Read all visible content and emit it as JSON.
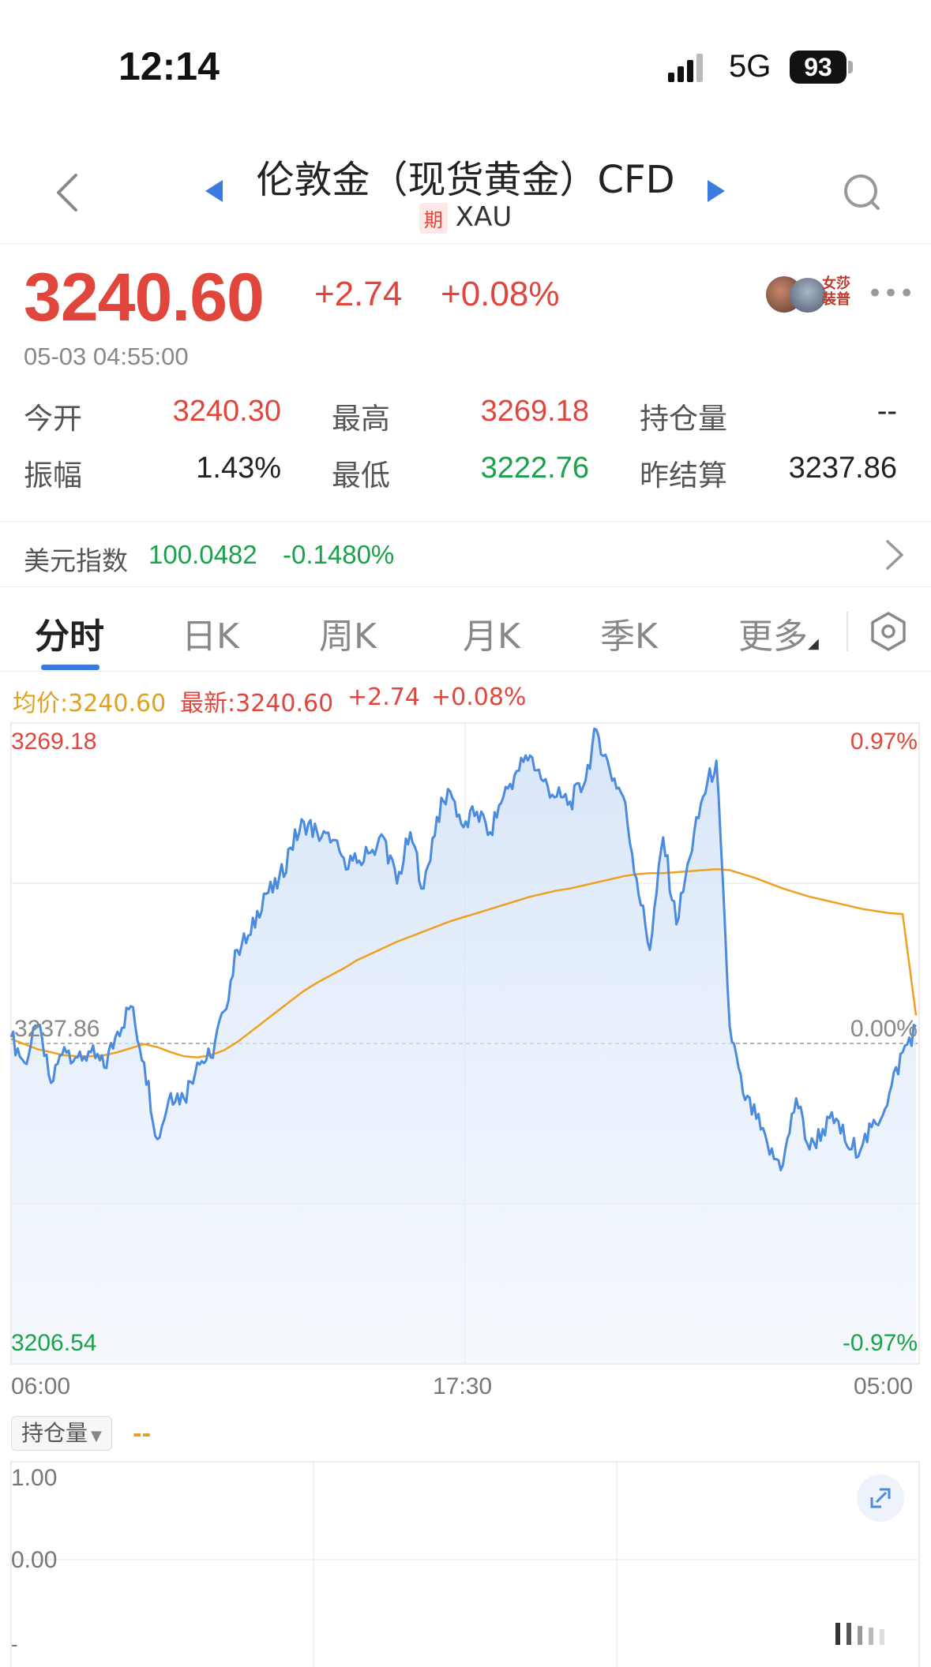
{
  "status_bar": {
    "time": "12:14",
    "network": "5G",
    "battery": "93"
  },
  "header": {
    "title": "伦敦金（现货黄金）CFD",
    "tag": "期",
    "symbol": "XAU"
  },
  "quote": {
    "price": "3240.60",
    "change": "+2.74",
    "change_pct": "+0.08%",
    "time": "05-03 04:55:00",
    "avatar_caption": "女莎\n装普"
  },
  "stats": {
    "open_label": "今开",
    "open": "3240.30",
    "high_label": "最高",
    "high": "3269.18",
    "oi_label": "持仓量",
    "oi": "--",
    "amp_label": "振幅",
    "amp": "1.43%",
    "low_label": "最低",
    "low": "3222.76",
    "prev_label": "昨结算",
    "prev": "3237.86"
  },
  "usd_index": {
    "label": "美元指数",
    "value": "100.0482",
    "change_pct": "-0.1480%"
  },
  "tabs": [
    "分时",
    "日K",
    "周K",
    "月K",
    "季K",
    "更多"
  ],
  "active_tab": "分时",
  "legend": {
    "avg": "均价:3240.60",
    "latest": "最新:3240.60",
    "change": "+2.74",
    "pct": "+0.08%"
  },
  "colors": {
    "red": "#e0463b",
    "green": "#1aa24a",
    "line": "#4a8be0",
    "avg": "#f0a020",
    "accent": "#3b7be0"
  },
  "chart_data": {
    "type": "line",
    "x_ticks": [
      "06:00",
      "17:30",
      "05:00"
    ],
    "y_max_label": "3269.18",
    "y_min_label": "3206.54",
    "y_base_label": "3237.86",
    "pct_max_label": "0.97%",
    "pct_min_label": "-0.97%",
    "pct_base_label": "0.00%",
    "ylim": [
      3206.54,
      3269.18
    ],
    "base": 3237.86,
    "series": [
      {
        "values": [
          3238.5,
          3236.0,
          3239.5,
          3234.0,
          3237.5,
          3236.5,
          3237.0,
          3235.5,
          3239.0,
          3241.5,
          3236.0,
          3228.5,
          3233.0,
          3232.5,
          3236.0,
          3236.5,
          3241.0,
          3247.0,
          3248.5,
          3252.5,
          3253.0,
          3257.0,
          3259.5,
          3258.5,
          3257.5,
          3256.0,
          3255.5,
          3256.5,
          3258.0,
          3253.5,
          3258.5,
          3253.0,
          3260.0,
          3262.5,
          3259.0,
          3260.5,
          3258.5,
          3262.0,
          3264.5,
          3266.0,
          3263.5,
          3262.0,
          3261.5,
          3263.0,
          3268.5,
          3264.5,
          3262.0,
          3254.0,
          3247.0,
          3258.0,
          3249.5,
          3256.0,
          3262.0,
          3265.5,
          3239.5,
          3233.0,
          3230.5,
          3227.0,
          3226.0,
          3232.5,
          3227.5,
          3229.5,
          3230.5,
          3227.5,
          3228.0,
          3230.0,
          3233.0,
          3237.0,
          3239.5
        ]
      },
      {
        "values": [
          3238.3,
          3237.8,
          3237.3,
          3237.0,
          3236.7,
          3236.6,
          3236.6,
          3236.7,
          3237.0,
          3237.4,
          3237.8,
          3237.5,
          3237.0,
          3236.6,
          3236.5,
          3236.7,
          3237.2,
          3238.0,
          3239.0,
          3240.0,
          3241.0,
          3242.0,
          3243.0,
          3243.8,
          3244.5,
          3245.2,
          3246.0,
          3246.6,
          3247.2,
          3247.8,
          3248.3,
          3248.8,
          3249.3,
          3249.8,
          3250.2,
          3250.6,
          3251.0,
          3251.4,
          3251.8,
          3252.2,
          3252.5,
          3252.8,
          3253.0,
          3253.3,
          3253.6,
          3253.9,
          3254.2,
          3254.4,
          3254.5,
          3254.5,
          3254.6,
          3254.7,
          3254.8,
          3254.9,
          3254.8,
          3254.4,
          3254.0,
          3253.5,
          3253.0,
          3252.6,
          3252.2,
          3251.9,
          3251.6,
          3251.3,
          3251.0,
          3250.8,
          3250.6,
          3250.5,
          3240.6
        ]
      }
    ]
  },
  "volume_panel": {
    "selector": "持仓量",
    "selector_value": "--",
    "y_top": "1.00",
    "y_bottom": "0.00",
    "corner": "-"
  }
}
